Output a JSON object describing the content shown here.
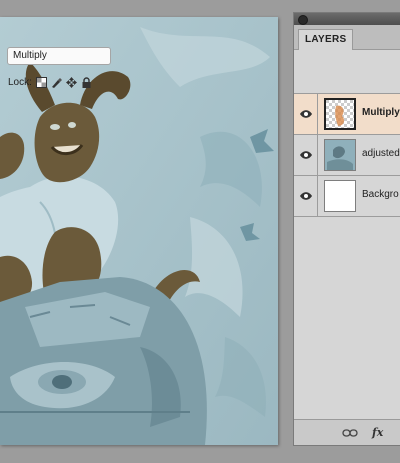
{
  "canvas": {
    "artwork": "illustration-canvas"
  },
  "layers_panel": {
    "tab_label": "LAYERS",
    "blend_mode": "Multiply",
    "lock_label": "Lock:",
    "layers": [
      {
        "name": "Multiply",
        "selected": true,
        "visible": true,
        "thumb": "transparent-sketch"
      },
      {
        "name": "adjusted",
        "selected": false,
        "visible": true,
        "thumb": "artwork"
      },
      {
        "name": "Backgro",
        "selected": false,
        "visible": true,
        "thumb": "white"
      }
    ],
    "bottom_icons": [
      "link-icon",
      "fx-icon"
    ],
    "fx_label": "fx"
  },
  "colors": {
    "canvas_bg": "#a9c4cc",
    "figure_brown": "#6b5a3a",
    "selected_row": "#f2ddca",
    "panel_bg": "#d6d6d6"
  }
}
